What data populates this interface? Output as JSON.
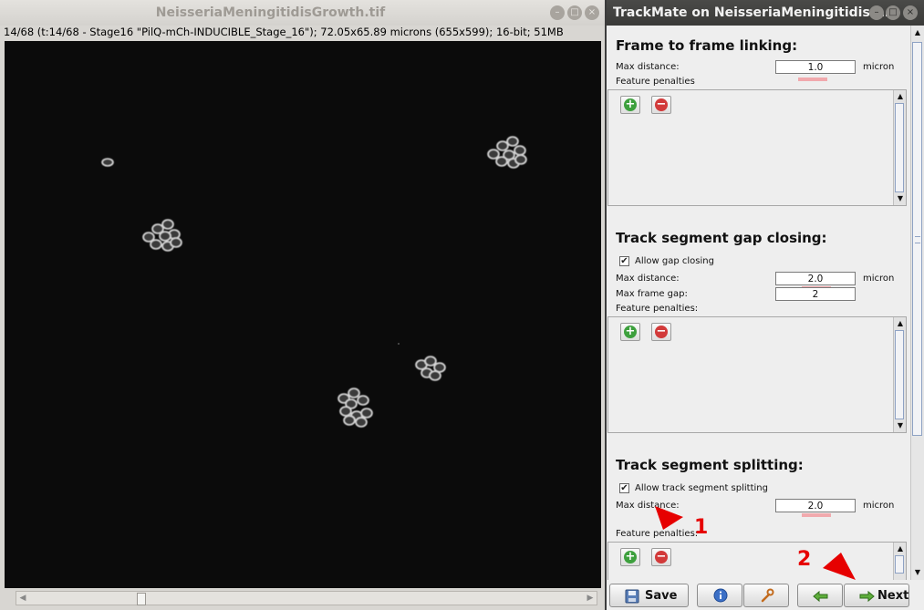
{
  "image_window": {
    "title": "NeisseriaMeningitidisGrowth.tif",
    "info": "14/68 (t:14/68 - Stage16 \"PilQ-mCh-INDUCIBLE_Stage_16\"); 72.05x65.89 microns (655x599); 16-bit; 51MB"
  },
  "trackmate": {
    "title": "TrackMate on NeisseriaMeningitidisG…",
    "frame_linking": {
      "heading": "Frame to frame linking:",
      "max_distance_label": "Max distance:",
      "max_distance_value": "1.0",
      "unit": "micron",
      "feature_penalties_label": "Feature penalties"
    },
    "gap_closing": {
      "heading": "Track segment gap closing:",
      "allow_label": "Allow gap closing",
      "allow_checked": "✔",
      "max_distance_label": "Max distance:",
      "max_distance_value": "2.0",
      "unit": "micron",
      "max_frame_gap_label": "Max frame gap:",
      "max_frame_gap_value": "2",
      "feature_penalties_label": "Feature penalties:"
    },
    "splitting": {
      "heading": "Track segment splitting:",
      "allow_label": "Allow track segment splitting",
      "allow_checked": "✔",
      "max_distance_label": "Max distance:",
      "max_distance_value": "2.0",
      "unit": "micron",
      "feature_penalties_label": "Feature penalties:"
    },
    "bottom_bar": {
      "save_label": "Save",
      "next_label": "Next"
    }
  },
  "annotations": {
    "marker_1": "1",
    "marker_2": "2",
    "color": "#e60000"
  },
  "icons": [
    "plus-icon",
    "minus-icon",
    "save-icon",
    "info-icon",
    "wrench-icon",
    "back-arrow-icon",
    "next-arrow-icon"
  ]
}
